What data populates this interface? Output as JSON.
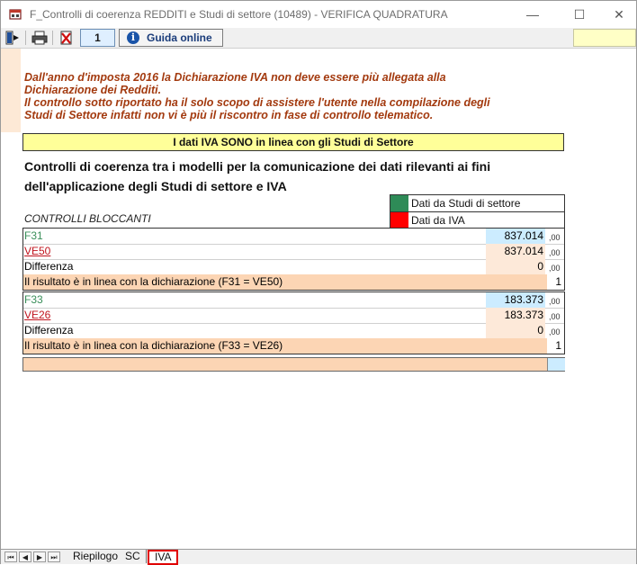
{
  "window": {
    "title": "F_Controlli di coerenza REDDITI e Studi di settore (10489) - VERIFICA QUADRATURA",
    "minimize": "—",
    "maximize": "☐",
    "close": "✕"
  },
  "toolbar": {
    "page_number": "1",
    "help_label": "Guida online",
    "help_icon_glyph": "i"
  },
  "notice": {
    "line1": "Dall'anno d'imposta 2016 la Dichiarazione IVA non deve essere più allegata alla",
    "line2": "Dichiarazione dei Redditi.",
    "line3": "Il controllo sotto riportato ha il solo scopo di assistere l'utente nella compilazione degli",
    "line4": "Studi di Settore infatti non vi è più il riscontro in fase di controllo telematico."
  },
  "banner": "I dati IVA SONO in linea con gli Studi di Settore",
  "heading": {
    "line1": "Controlli di coerenza  tra i modelli per la comunicazione dei dati rilevanti ai fini",
    "line2": "dell'applicazione degli Studi di settore e IVA"
  },
  "legend": {
    "items": [
      {
        "label": "Dati da Studi di settore",
        "color": "#2e8b57"
      },
      {
        "label": "Dati da IVA",
        "color": "#ff0000"
      }
    ]
  },
  "controls_label": "CONTROLLI BLOCCANTI",
  "blocks": [
    {
      "rows": [
        {
          "label": "F31",
          "value": "837.014",
          "dec": ",00"
        },
        {
          "label": "VE50",
          "value": "837.014",
          "dec": ",00"
        },
        {
          "label": "Differenza",
          "value": "0",
          "dec": ",00"
        }
      ],
      "result_label": "Il risultato è in linea con la dichiarazione (F31 = VE50)",
      "result_value": "1"
    },
    {
      "rows": [
        {
          "label": "F33",
          "value": "183.373",
          "dec": ",00"
        },
        {
          "label": "VE26",
          "value": "183.373",
          "dec": ",00"
        },
        {
          "label": "Differenza",
          "value": "0",
          "dec": ",00"
        }
      ],
      "result_label": "Il risultato è in linea con la dichiarazione (F33 = VE26)",
      "result_value": "1"
    }
  ],
  "colors": {
    "sds_cell": "#ccecff",
    "iva_cell": "#fde9d9",
    "result_row": "#fcd5b4",
    "banner": "#ffff99",
    "notice_text": "#a33a0f"
  },
  "tabs": {
    "nav": [
      "⏮",
      "◀",
      "▶",
      "⏭"
    ],
    "items": [
      {
        "label": "Riepilogo",
        "active": false
      },
      {
        "label": "SC",
        "active": false
      },
      {
        "label": "IVA",
        "active": true
      }
    ]
  }
}
